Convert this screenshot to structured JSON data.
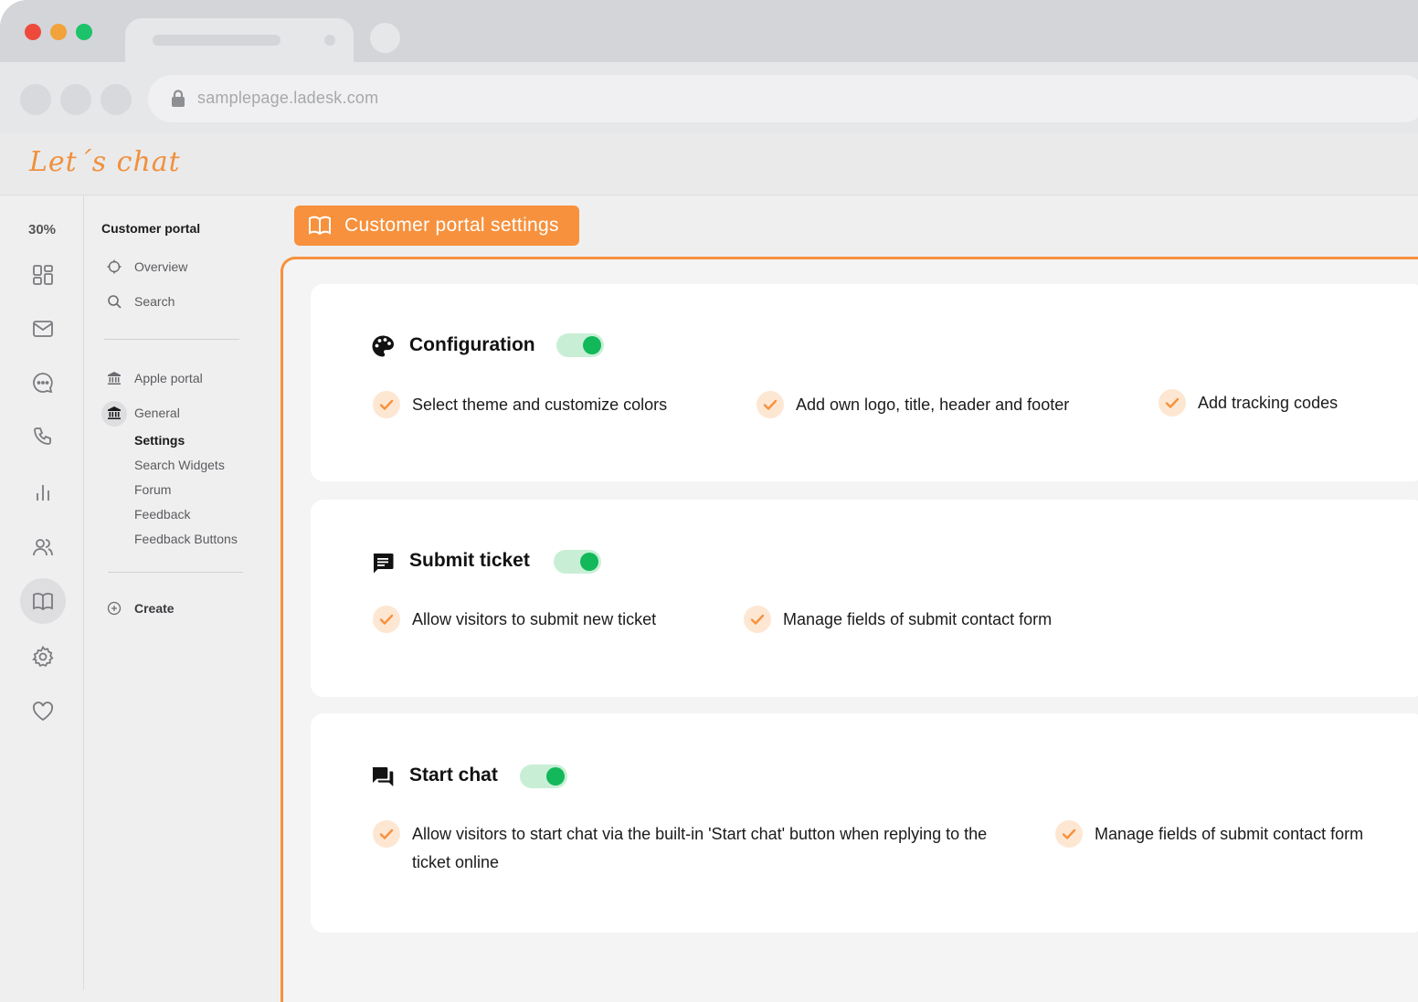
{
  "browser": {
    "url": "samplepage.ladesk.com"
  },
  "header": {
    "logo_text": "Let´s chat"
  },
  "icon_rail": {
    "progress_label": "30%",
    "icons": [
      "dashboard-icon",
      "mail-icon",
      "chat-icon",
      "phone-icon",
      "reports-icon",
      "contacts-icon",
      "knowledgebase-icon",
      "settings-icon",
      "heart-icon"
    ],
    "active": "knowledgebase-icon"
  },
  "sidebar": {
    "title": "Customer portal",
    "top_items": [
      {
        "label": "Overview",
        "icon": "overview-icon"
      },
      {
        "label": "Search",
        "icon": "search-icon"
      }
    ],
    "portals": [
      {
        "label": "Apple portal",
        "icon": "bank-icon"
      },
      {
        "label": "General",
        "icon": "bank-icon"
      }
    ],
    "sub_items": [
      {
        "label": "Settings",
        "active": true
      },
      {
        "label": "Search Widgets"
      },
      {
        "label": "Forum"
      },
      {
        "label": "Feedback"
      },
      {
        "label": "Feedback Buttons"
      }
    ],
    "create_label": "Create"
  },
  "main": {
    "tab_label": "Customer portal settings",
    "cards": [
      {
        "title": "Configuration",
        "icon": "palette-icon",
        "enabled": true,
        "features": [
          "Select theme and customize colors",
          "Add own logo, title, header and footer",
          "Add tracking codes"
        ]
      },
      {
        "title": "Submit ticket",
        "icon": "message-icon",
        "enabled": true,
        "features": [
          "Allow visitors to submit new ticket",
          "Manage fields of submit contact form"
        ]
      },
      {
        "title": "Start chat",
        "icon": "chat-bubbles-icon",
        "enabled": true,
        "features": [
          "Allow visitors to start chat via the built-in 'Start chat' button when replying to the ticket online",
          "Manage fields of submit contact form"
        ]
      }
    ]
  },
  "colors": {
    "accent": "#f7913d",
    "toggle_on": "#12b85a",
    "check_bg": "#fde7d3"
  }
}
